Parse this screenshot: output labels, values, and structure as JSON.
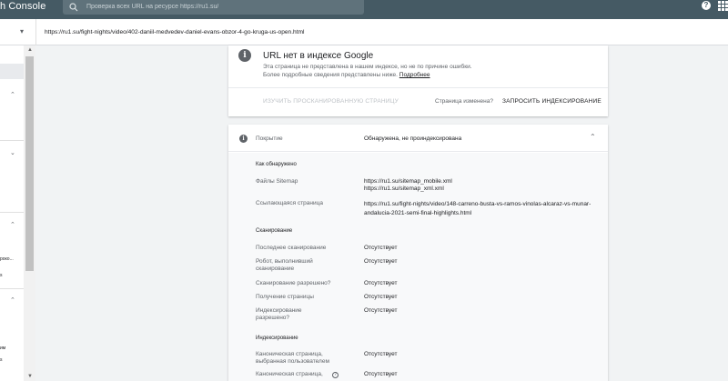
{
  "app": {
    "title_visible": "h Console",
    "search_placeholder": "Проверка всех URL на ресурсе https://ru1.su/"
  },
  "urlbar": {
    "url": "https://ru1.su/fight-nights/video/402-daniil-medvedev-daniel-evans-obzor-4-go-kruga-us-open.html"
  },
  "sidebar": {
    "texts": [
      "роко...",
      "s",
      "им",
      "s"
    ]
  },
  "status_card": {
    "heading": "URL нет в индексе Google",
    "desc_line1": "Эта страница не представлена в нашем индексе, но не по причине ошибки.",
    "desc_line2": "Более подробные сведения представлены ниже.",
    "desc_link": "Подробнее",
    "inspect_button": "ИЗУЧИТЬ ПРОСКАНИРОВАННУЮ СТРАНИЦУ",
    "page_changed": "Страница изменена?",
    "request_button": "ЗАПРОСИТЬ ИНДЕКСИРОВАНИЕ"
  },
  "coverage": {
    "label": "Покрытие",
    "status": "Обнаружена, не проиндексирована",
    "sections": {
      "discovery": {
        "title": "Как обнаружено",
        "sitemaps_label": "Файлы Sitemap",
        "sitemaps": [
          "https://ru1.su/sitemap_mobile.xml",
          "https://ru1.su/sitemap_xml.xml"
        ],
        "referring_label": "Ссылающаяся страница",
        "referring": "https://ru1.su/fight-nights/video/148-carreno-busta-vs-ramos-vinolas-alcaraz-vs-munar-andalucia-2021-semi-final-highlights.html"
      },
      "crawl": {
        "title": "Сканирование",
        "rows": [
          {
            "label": "Последнее сканирование",
            "value": "Отсутствует"
          },
          {
            "label": "Робот, выполнивший сканирование",
            "value": "Отсутствует"
          },
          {
            "label": "Сканирование разрешено?",
            "value": "Отсутствует"
          },
          {
            "label": "Получение страницы",
            "value": "Отсутствует"
          },
          {
            "label": "Индексирование разрешено?",
            "value": "Отсутствует"
          }
        ]
      },
      "indexing": {
        "title": "Индексирование",
        "rows": [
          {
            "label": "Каноническая страница, выбранная пользователем",
            "value": "Отсутствует"
          },
          {
            "label": "Каноническая страница,",
            "value": "Отсутствует"
          }
        ]
      }
    }
  },
  "colors": {
    "header_bg": "#455a64",
    "page_bg": "#f1f3f4",
    "card_bg": "#ffffff",
    "expanded_bg": "#f8f9fa"
  }
}
